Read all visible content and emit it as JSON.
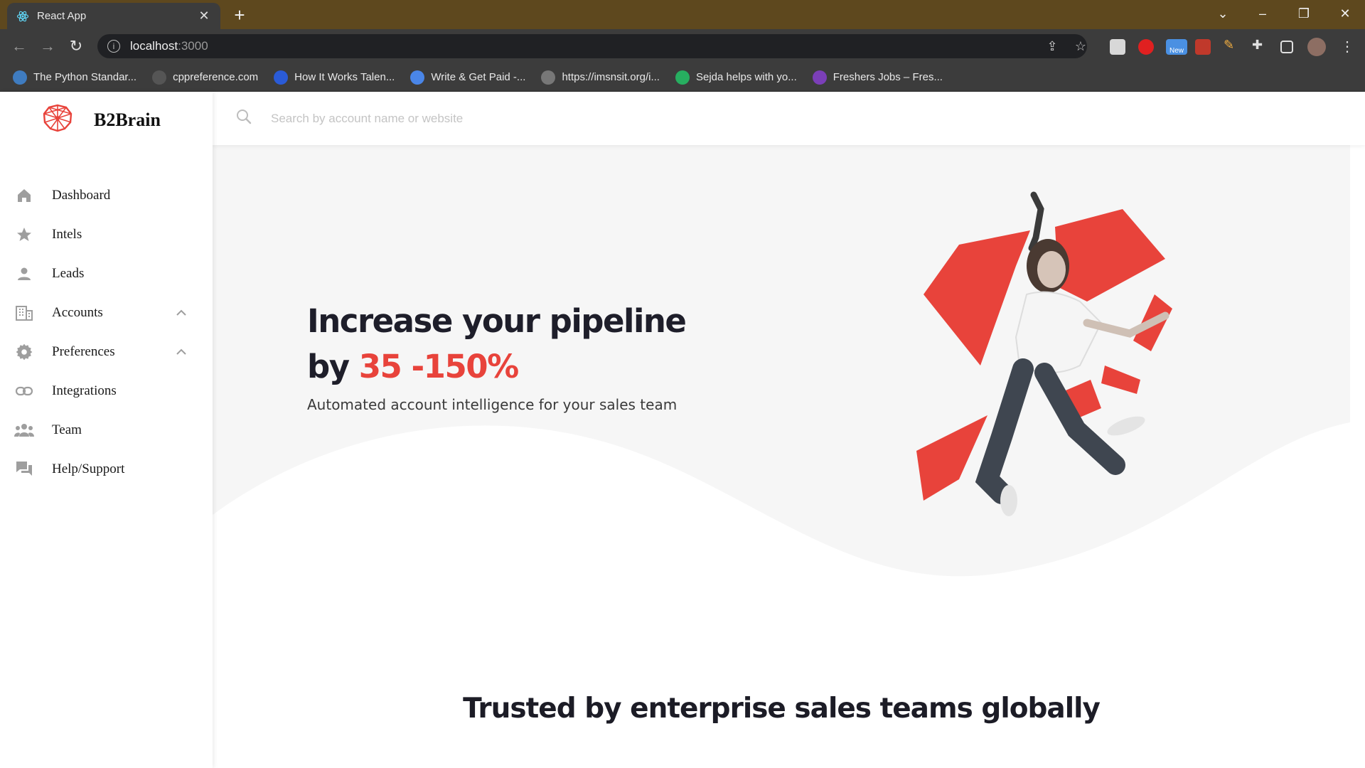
{
  "browser": {
    "tab_title": "React App",
    "address_host": "localhost",
    "address_port": ":3000",
    "extension_new_badge": "New",
    "bookmarks": [
      {
        "label": "The Python Standar...",
        "icon": "python-icon",
        "color": "#3f7cc0"
      },
      {
        "label": "cppreference.com",
        "icon": "cppreference-icon",
        "color": "#555555"
      },
      {
        "label": "How It Works Talen...",
        "icon": "v-icon",
        "color": "#2a5bd7"
      },
      {
        "label": "Write & Get Paid -...",
        "icon": "document-icon",
        "color": "#4a86e8"
      },
      {
        "label": "https://imsnsit.org/i...",
        "icon": "globe-icon",
        "color": "#777777"
      },
      {
        "label": "Sejda helps with yo...",
        "icon": "sejda-icon",
        "color": "#27ae60"
      },
      {
        "label": "Freshers Jobs – Fres...",
        "icon": "fn-icon",
        "color": "#7b3fb8"
      }
    ]
  },
  "app": {
    "brand": "B2Brain",
    "search_placeholder": "Search by account name or website",
    "nav": [
      {
        "label": "Dashboard",
        "icon": "home-icon",
        "expandable": false
      },
      {
        "label": "Intels",
        "icon": "star-icon",
        "expandable": false
      },
      {
        "label": "Leads",
        "icon": "person-icon",
        "expandable": false
      },
      {
        "label": "Accounts",
        "icon": "building-icon",
        "expandable": true
      },
      {
        "label": "Preferences",
        "icon": "gear-icon",
        "expandable": true
      },
      {
        "label": "Integrations",
        "icon": "link-icon",
        "expandable": false
      },
      {
        "label": "Team",
        "icon": "group-icon",
        "expandable": false
      },
      {
        "label": "Help/Support",
        "icon": "chat-icon",
        "expandable": false
      }
    ],
    "hero": {
      "title_line1": "Increase your pipeline",
      "title_line2_prefix": "by ",
      "title_line2_accent": "35 -150%",
      "subtitle": "Automated account intelligence for your sales team"
    },
    "trusted_heading": "Trusted by enterprise sales teams globally"
  },
  "colors": {
    "accent": "#e8433b",
    "brand_red": "#e8433b",
    "chrome_tab": "#5e481e",
    "chrome_toolbar": "#3c3c3c"
  }
}
